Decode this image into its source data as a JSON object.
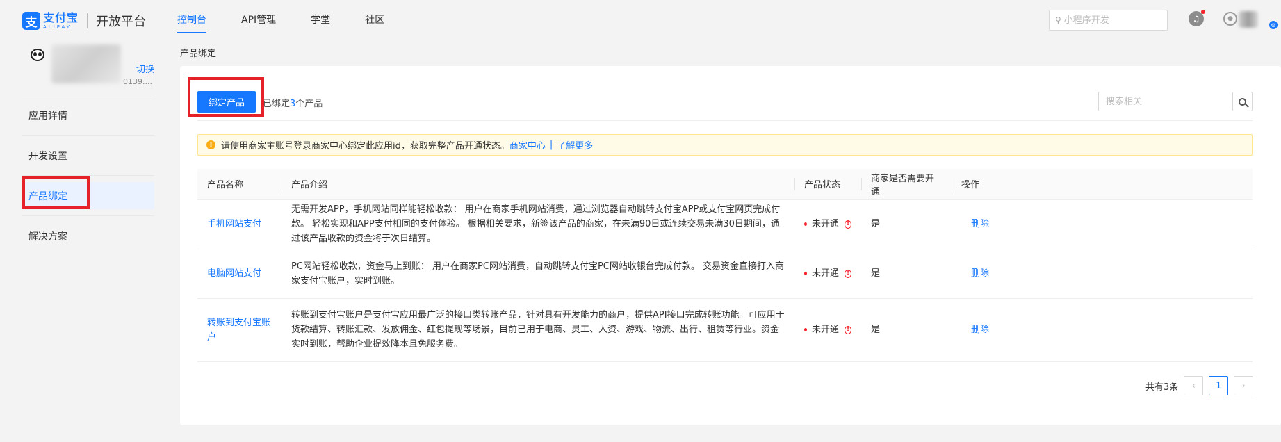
{
  "header": {
    "logo_mark": "支",
    "logo_cn": "支付宝",
    "logo_en": "ALIPAY",
    "platform": "开放平台",
    "nav": [
      {
        "label": "控制台",
        "active": true
      },
      {
        "label": "API管理",
        "active": false
      },
      {
        "label": "学堂",
        "active": false
      },
      {
        "label": "社区",
        "active": false
      }
    ],
    "search_placeholder": "小程序开发"
  },
  "sidebar": {
    "app_id_suffix": "0139....",
    "switch_label": "切换",
    "items": [
      {
        "label": "应用详情",
        "active": false
      },
      {
        "label": "开发设置",
        "active": false
      },
      {
        "label": "产品绑定",
        "active": true
      },
      {
        "label": "解决方案",
        "active": false
      }
    ]
  },
  "main": {
    "breadcrumb": "产品绑定",
    "bind_button": "绑定产品",
    "bound_prefix": "已绑定",
    "bound_count": "3",
    "bound_suffix": "个产品",
    "search_placeholder": "搜索相关",
    "notice": {
      "text": "请使用商家主账号登录商家中心绑定此应用id，获取完整产品开通状态。",
      "link1": "商家中心",
      "separator": "|",
      "link2": "了解更多"
    },
    "table": {
      "columns": [
        "产品名称",
        "产品介绍",
        "产品状态",
        "商家是否需要开通",
        "操作"
      ],
      "rows": [
        {
          "name": "手机网站支付",
          "description": "无需开发APP，手机网站同样能轻松收款： 用户在商家手机网站消费，通过浏览器自动跳转支付宝APP或支付宝网页完成付款。 轻松实现和APP支付相同的支付体验。 根据相关要求，新签该产品的商家，在未满90日或连续交易未满30日期间，通过该产品收款的资金将于次日结算。",
          "status": "未开通",
          "merchant_required": "是",
          "action": "删除"
        },
        {
          "name": "电脑网站支付",
          "description": "PC网站轻松收款，资金马上到账： 用户在商家PC网站消费，自动跳转支付宝PC网站收银台完成付款。 交易资金直接打入商家支付宝账户，实时到账。",
          "status": "未开通",
          "merchant_required": "是",
          "action": "删除"
        },
        {
          "name": "转账到支付宝账户",
          "description": "转账到支付宝账户是支付宝应用最广泛的接口类转账产品，针对具有开发能力的商户，提供API接口完成转账功能。可应用于货款结算、转账汇款、发放佣金、红包提现等场景，目前已用于电商、灵工、人资、游戏、物流、出行、租赁等行业。资金实时到账，帮助企业提效降本且免服务费。",
          "status": "未开通",
          "merchant_required": "是",
          "action": "删除"
        }
      ]
    },
    "pagination": {
      "total": "共有3条",
      "prev": "‹",
      "current": "1",
      "next": "›"
    }
  },
  "colors": {
    "accent": "#1677ff",
    "highlight": "#e5212a",
    "warning": "#faad14",
    "error": "#f5222d"
  }
}
